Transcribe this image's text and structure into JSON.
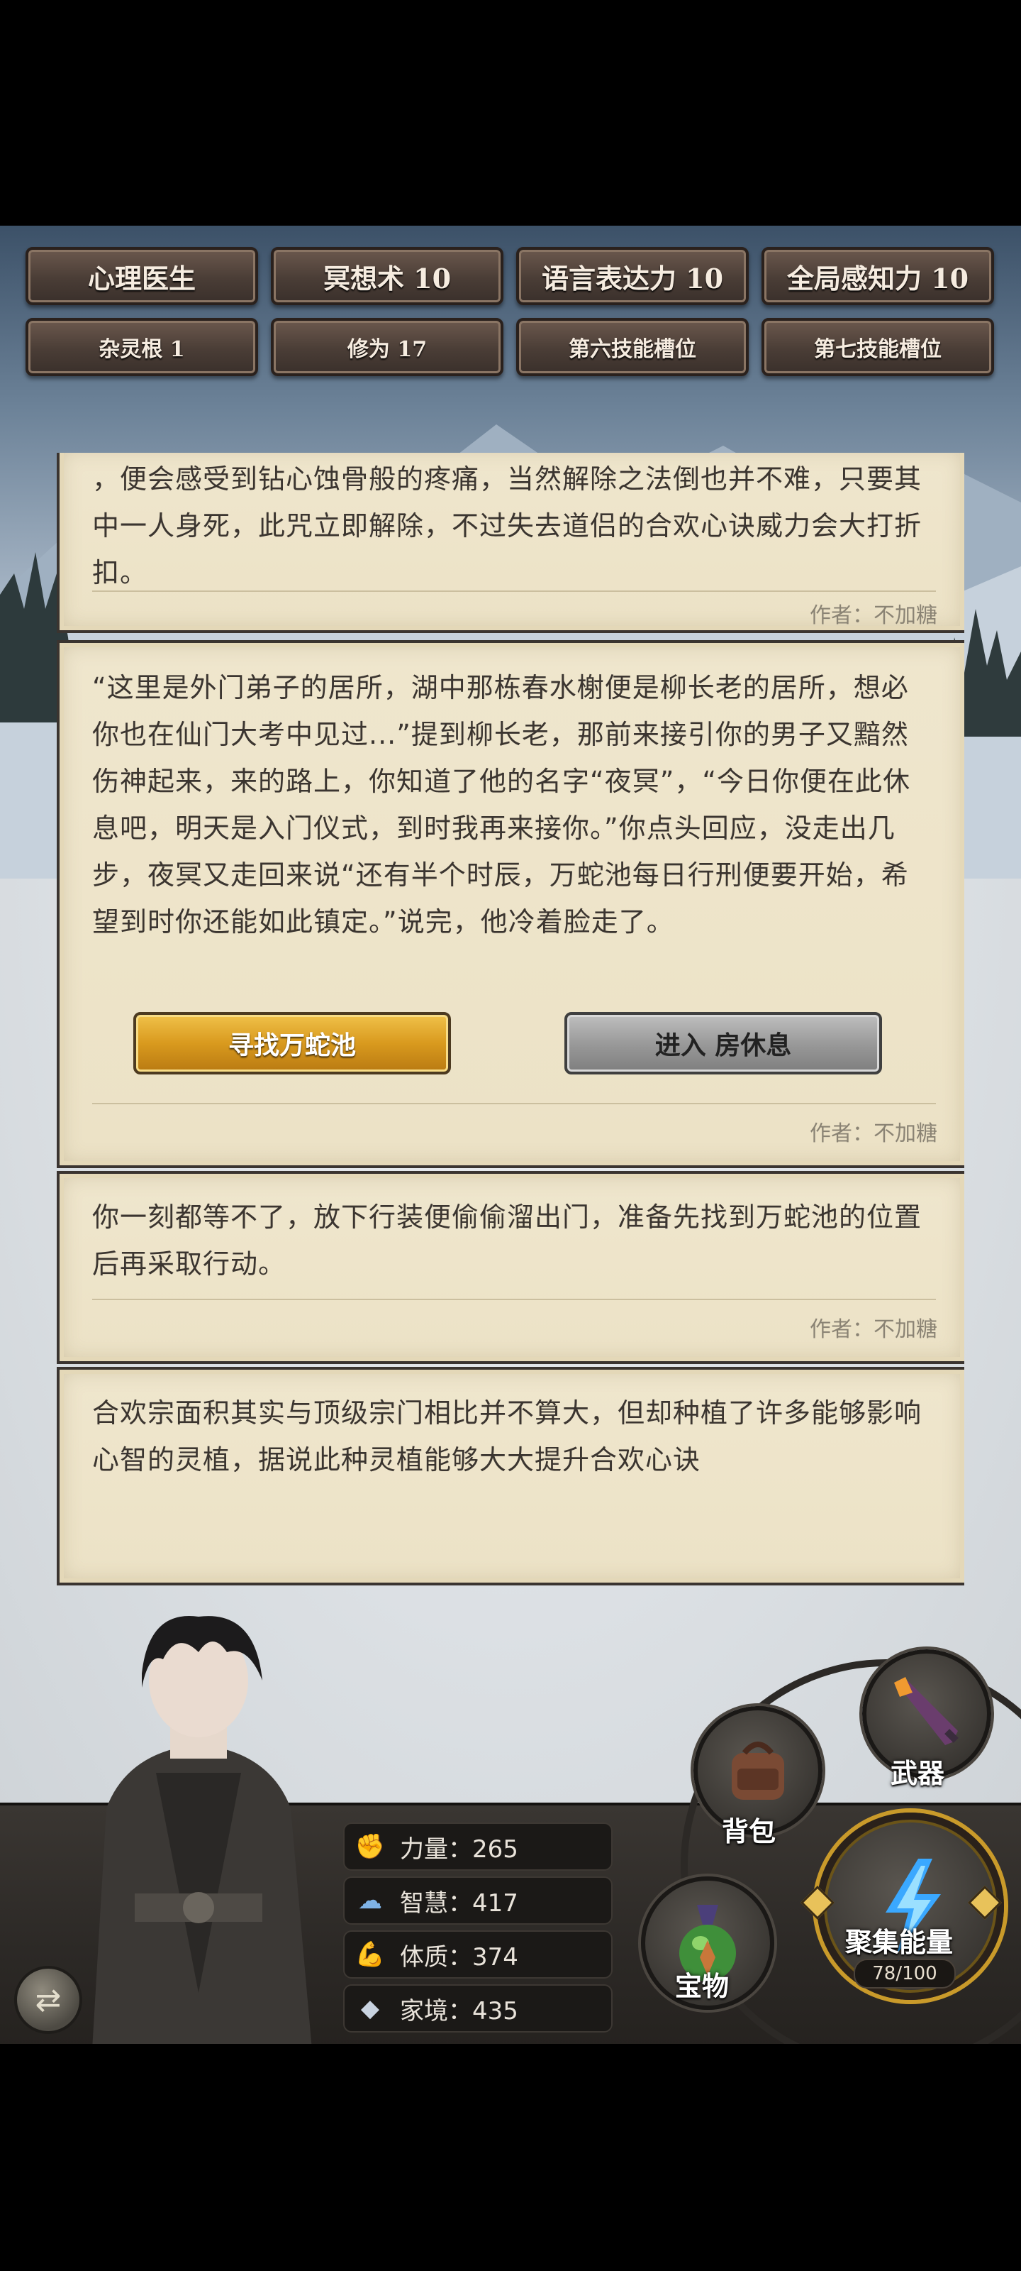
{
  "skills": [
    "心理医生",
    "冥想术 10",
    "语言表达力 10",
    "全局感知力 10",
    "杂灵根 1",
    "修为 17",
    "第六技能槽位",
    "第七技能槽位"
  ],
  "cards": [
    {
      "text": "，便会感受到钻心蚀骨般的疼痛，当然解除之法倒也并不难，只要其中一人身死，此咒立即解除，不过失去道侣的合欢心诀威力会大打折扣。",
      "author": "作者：不加糖"
    },
    {
      "text": "“这里是外门弟子的居所，湖中那栋春水榭便是柳长老的居所，想必你也在仙门大考中见过...”提到柳长老，那前来接引你的男子又黯然伤神起来，来的路上，你知道了他的名字“夜冥”，“今日你便在此休息吧，明天是入门仪式，到时我再来接你。”你点头回应，没走出几步，夜冥又走回来说“还有半个时辰，万蛇池每日行刑便要开始，希望到时你还能如此镇定。”说完，他冷着脸走了。",
      "choices": [
        "寻找万蛇池",
        "进入 房休息"
      ],
      "author": "作者：不加糖"
    },
    {
      "text": "你一刻都等不了，放下行装便偷偷溜出门，准备先找到万蛇池的位置后再采取行动。",
      "author": "作者：不加糖"
    },
    {
      "text": "合欢宗面积其实与顶级宗门相比并不算大，但却种植了许多能够影响心智的灵植，据说此种灵植能够大大提升合欢心诀"
    }
  ],
  "stats": [
    {
      "icon": "fist-icon",
      "label": "力量：265"
    },
    {
      "icon": "brain-icon",
      "label": "智慧：417"
    },
    {
      "icon": "muscle-icon",
      "label": "体质：374"
    },
    {
      "icon": "diamond-icon",
      "label": "家境：435"
    }
  ],
  "actions": {
    "weapon": "武器",
    "backpack": "背包",
    "treasure": "宝物",
    "gather": "聚集能量",
    "energy": "78/100",
    "energy_fraction": 0.78
  },
  "colors": {
    "gold_button": "#d99a1e",
    "grey_button": "#9a9a9a",
    "parchment": "#ece2c6",
    "energy_blue": "#3aa8ff"
  }
}
